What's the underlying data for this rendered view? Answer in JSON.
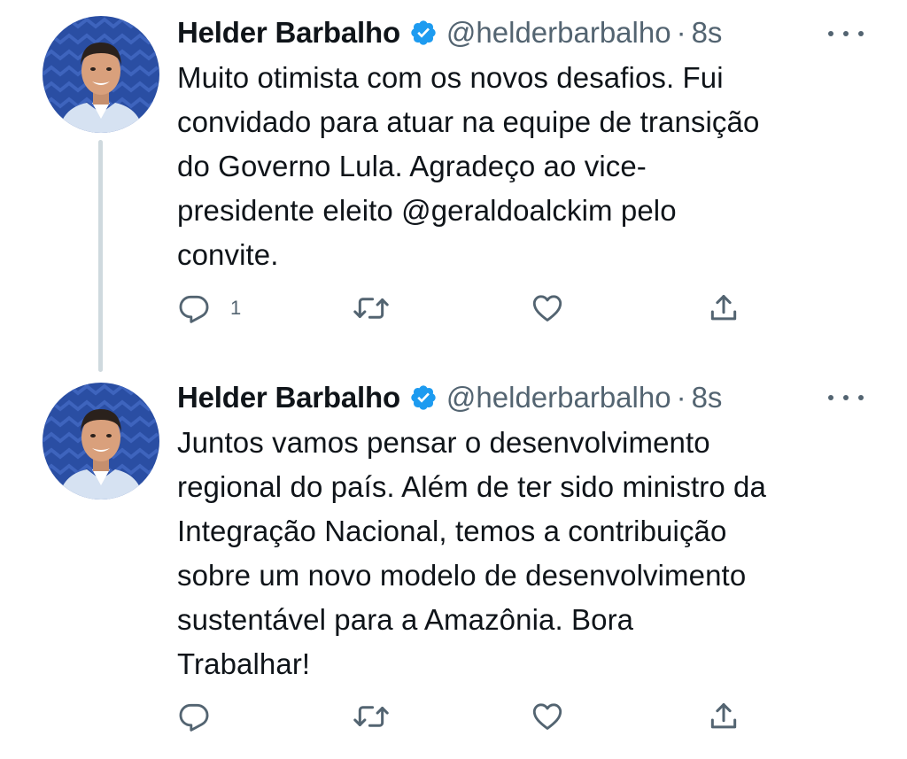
{
  "colors": {
    "text": "#0f1419",
    "secondary": "#536471",
    "verified": "#1d9bf0",
    "thread_line": "#cfd9de",
    "avatar_bg": "#2a4ea3"
  },
  "tweets": [
    {
      "author": {
        "name": "Helder Barbalho",
        "handle": "@helderbarbalho",
        "verified_icon": "verified-badge-icon",
        "avatar_icon": "profile-photo"
      },
      "separator": "·",
      "time": "8s",
      "text": "Muito otimista com os novos desafios. Fui\nconvidado para atuar na equipe de transição\ndo Governo Lula. Agradeço ao vice-\npresidente eleito @geraldoalckim pelo\nconvite.",
      "actions": {
        "reply_count": "1",
        "retweet_count": "",
        "like_count": ""
      }
    },
    {
      "author": {
        "name": "Helder Barbalho",
        "handle": "@helderbarbalho",
        "verified_icon": "verified-badge-icon",
        "avatar_icon": "profile-photo"
      },
      "separator": "·",
      "time": "8s",
      "text": "Juntos vamos pensar o desenvolvimento\nregional do país. Além de ter sido ministro da\nIntegração Nacional, temos a contribuição\nsobre um novo modelo de desenvolvimento\nsustentável para a Amazônia. Bora\nTrabalhar!",
      "actions": {
        "reply_count": "",
        "retweet_count": "",
        "like_count": ""
      }
    }
  ]
}
